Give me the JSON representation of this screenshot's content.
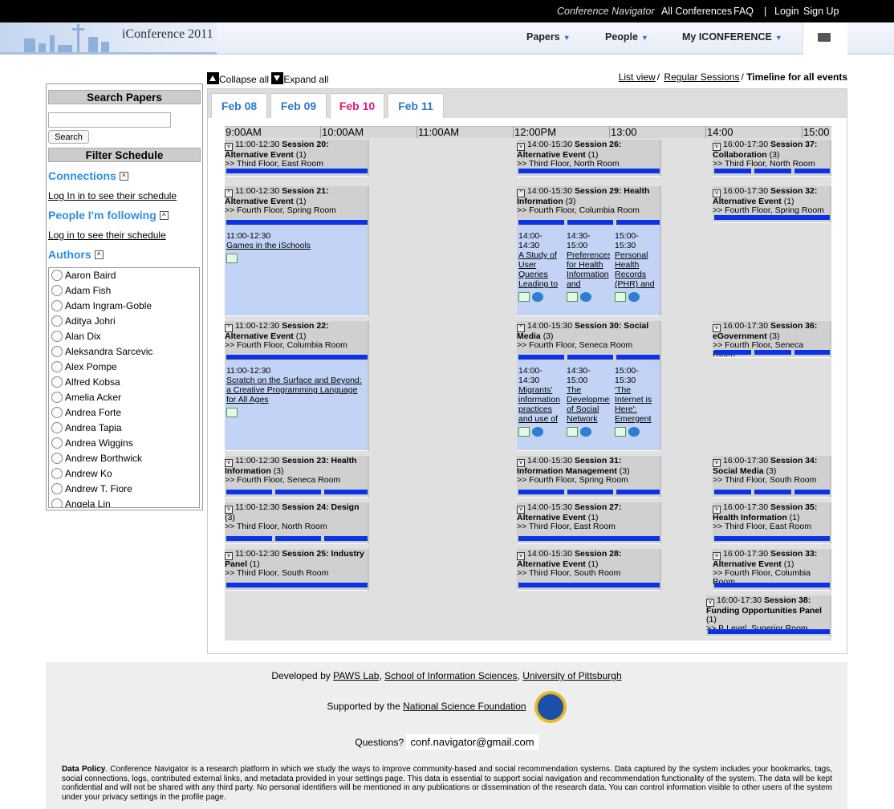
{
  "topbar": {
    "brand": "Conference Navigator",
    "all_conferences": "All Conferences",
    "faq": "FAQ",
    "separator": "|",
    "login": "Login",
    "signup": "Sign Up"
  },
  "header": {
    "logo": "iConference 2011",
    "menu": [
      {
        "label": "Papers"
      },
      {
        "label": "People"
      },
      {
        "label": "My ICONFERENCE"
      }
    ],
    "menu_caret": "▼"
  },
  "view": {
    "collapse_all": "Collapse all",
    "expand_all": "Expand all",
    "list_view": "List view",
    "regular_sessions": "Regular Sessions",
    "slash": "/",
    "timeline": "Timeline for all events"
  },
  "sidebar": {
    "search_title": "Search Papers",
    "search_button": "Search",
    "filter_title": "Filter Schedule",
    "connections": "Connections",
    "connections_link": "Log In in to see their schedule",
    "following": "People I'm following",
    "following_link": "Log in to see their schedule",
    "authors_title": "Authors",
    "authors": [
      "Aaron Baird",
      "Adam Fish",
      "Adam Ingram-Goble",
      "Aditya Johri",
      "Alan Dix",
      "Aleksandra Sarcevic",
      "Alex Pompe",
      "Alfred Kobsa",
      "Amelia Acker",
      "Andrea Forte",
      "Andrea Tapia",
      "Andrea Wiggins",
      "Andrew Borthwick",
      "Andrew Ko",
      "Andrew T. Fiore",
      "Angela Lin"
    ]
  },
  "tabs": [
    {
      "label": "Feb 08"
    },
    {
      "label": "Feb 09"
    },
    {
      "label": "Feb 10"
    },
    {
      "label": "Feb 11"
    }
  ],
  "timeline": {
    "hours": [
      "9:00AM",
      "10:00AM",
      "11:00AM",
      "12:00PM",
      "13:00",
      "14:00",
      "15:00"
    ]
  },
  "sessions": [
    {
      "time": "11:00-12:30",
      "title": "Session 20: Alternative Event",
      "count": "(1)",
      "room": ">> Third Floor, East Room",
      "papers": []
    },
    {
      "time": "11:00-12:30",
      "title": "Session 21: Alternative Event",
      "count": "(1)",
      "room": ">> Fourth Floor, Spring Room",
      "papers": [
        {
          "time": "11:00-12:30",
          "title": "Games in the iSchools"
        }
      ]
    },
    {
      "time": "11:00-12:30",
      "title": "Session 22: Alternative Event",
      "count": "(1)",
      "room": ">> Fourth Floor, Columbia Room",
      "papers": [
        {
          "time": "11:00-12:30",
          "title": "Scratch on the Surface and Beyond: a Creative Programming Language for All Ages"
        }
      ]
    },
    {
      "time": "11:00-12:30",
      "title": "Session 23: Health Information",
      "count": "(3)",
      "room": ">> Fourth Floor, Seneca Room",
      "papers": []
    },
    {
      "time": "11:00-12:30",
      "title": "Session 24: Design",
      "count": "(3)",
      "room": ">> Third Floor, North Room",
      "papers": []
    },
    {
      "time": "11:00-12:30",
      "title": "Session 25: Industry Panel",
      "count": "(1)",
      "room": ">> Third Floor, South Room",
      "papers": []
    },
    {
      "time": "14:00-15:30",
      "title": "Session 26: Alternative Event",
      "count": "(1)",
      "room": ">> Third Floor, North Room",
      "papers": []
    },
    {
      "time": "14:00-15:30",
      "title": "Session 29: Health Information",
      "count": "(3)",
      "room": ">> Fourth Floor, Columbia Room",
      "papers": [
        {
          "time": "14:00-14:30",
          "title": "A Study of User Queries Leading to"
        },
        {
          "time": "14:30-15:00",
          "title": "Preferences for Health Information and"
        },
        {
          "time": "15:00-15:30",
          "title": "Personal Health Records (PHR) and"
        }
      ]
    },
    {
      "time": "14:00-15:30",
      "title": "Session 30: Social Media",
      "count": "(3)",
      "room": ">> Fourth Floor, Seneca Room",
      "papers": [
        {
          "time": "14:00-14:30",
          "title": "Migrants' information practices and use of"
        },
        {
          "time": "14:30-15:00",
          "title": "The Development of Social Network"
        },
        {
          "time": "15:00-15:30",
          "title": "'The Internet is Here': Emergent"
        }
      ]
    },
    {
      "time": "14:00-15:30",
      "title": "Session 31: Information Management",
      "count": "(3)",
      "room": ">> Fourth Floor, Spring Room",
      "papers": []
    },
    {
      "time": "14:00-15:30",
      "title": "Session 27: Alternative Event",
      "count": "(1)",
      "room": ">> Third Floor, East Room",
      "papers": []
    },
    {
      "time": "14:00-15:30",
      "title": "Session 28: Alternative Event",
      "count": "(1)",
      "room": ">> Third Floor, South Room",
      "papers": []
    },
    {
      "time": "16:00-17:30",
      "title": "Session 37: Collaboration",
      "count": "(3)",
      "room": ">> Third Floor, North Room",
      "papers": []
    },
    {
      "time": "16:00-17:30",
      "title": "Session 32: Alternative Event",
      "count": "(1)",
      "room": ">> Fourth Floor, Spring Room",
      "papers": []
    },
    {
      "time": "16:00-17:30",
      "title": "Session 36: eGovernment",
      "count": "(3)",
      "room": ">> Fourth Floor, Seneca Room",
      "papers": []
    },
    {
      "time": "16:00-17:30",
      "title": "Session 34: Social Media",
      "count": "(3)",
      "room": ">> Third Floor, South Room",
      "papers": []
    },
    {
      "time": "16:00-17:30",
      "title": "Session 35: Health Information",
      "count": "(1)",
      "room": ">> Third Floor, East Room",
      "papers": []
    },
    {
      "time": "16:00-17:30",
      "title": "Session 33: Alternative Event",
      "count": "(1)",
      "room": ">> Fourth Floor, Columbia Room",
      "papers": []
    },
    {
      "time": "16:00-17:30",
      "title": "Session 38: Funding Opportunities Panel",
      "count": "(1)",
      "room": ">> B Level, Superior Room",
      "papers": []
    }
  ],
  "footer": {
    "dev_prefix": "Developed by ",
    "paws": "PAWS Lab",
    "comma": ",",
    "sis": "School of Information Sciences",
    "pitt": "University of Pittsburgh",
    "supported_prefix": "Supported by the ",
    "nsf": "National Science Foundation",
    "questions": "Questions?",
    "email": "conf.navigator@gmail.com",
    "policy_label": "Data Policy",
    "policy": ". Conference Navigator is a research platform in which we study the ways to improve community-based and social recommendation systems. Data captured by the system includes your bookmarks, tags, social connections, logs, contributed external links, and metadata provided in your settings page. This data is essential to support social navigation and recommendation functionality of the system. The data will be kept confidential and will not be shared with any third party. No personal identifiers will be mentioned in any publications or dissemination of the research data. You can control information visible to other users of the system under your privacy settings in the profile page."
  }
}
